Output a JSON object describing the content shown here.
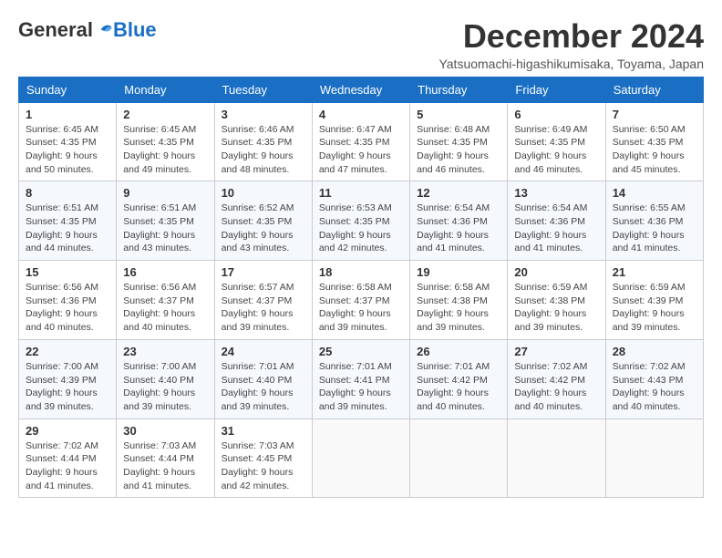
{
  "logo": {
    "general": "General",
    "blue": "Blue"
  },
  "title": "December 2024",
  "location": "Yatsuomachi-higashikumisaka, Toyama, Japan",
  "days_of_week": [
    "Sunday",
    "Monday",
    "Tuesday",
    "Wednesday",
    "Thursday",
    "Friday",
    "Saturday"
  ],
  "weeks": [
    [
      {
        "day": "1",
        "sunrise": "6:45 AM",
        "sunset": "4:35 PM",
        "daylight": "9 hours and 50 minutes."
      },
      {
        "day": "2",
        "sunrise": "6:45 AM",
        "sunset": "4:35 PM",
        "daylight": "9 hours and 49 minutes."
      },
      {
        "day": "3",
        "sunrise": "6:46 AM",
        "sunset": "4:35 PM",
        "daylight": "9 hours and 48 minutes."
      },
      {
        "day": "4",
        "sunrise": "6:47 AM",
        "sunset": "4:35 PM",
        "daylight": "9 hours and 47 minutes."
      },
      {
        "day": "5",
        "sunrise": "6:48 AM",
        "sunset": "4:35 PM",
        "daylight": "9 hours and 46 minutes."
      },
      {
        "day": "6",
        "sunrise": "6:49 AM",
        "sunset": "4:35 PM",
        "daylight": "9 hours and 46 minutes."
      },
      {
        "day": "7",
        "sunrise": "6:50 AM",
        "sunset": "4:35 PM",
        "daylight": "9 hours and 45 minutes."
      }
    ],
    [
      {
        "day": "8",
        "sunrise": "6:51 AM",
        "sunset": "4:35 PM",
        "daylight": "9 hours and 44 minutes."
      },
      {
        "day": "9",
        "sunrise": "6:51 AM",
        "sunset": "4:35 PM",
        "daylight": "9 hours and 43 minutes."
      },
      {
        "day": "10",
        "sunrise": "6:52 AM",
        "sunset": "4:35 PM",
        "daylight": "9 hours and 43 minutes."
      },
      {
        "day": "11",
        "sunrise": "6:53 AM",
        "sunset": "4:35 PM",
        "daylight": "9 hours and 42 minutes."
      },
      {
        "day": "12",
        "sunrise": "6:54 AM",
        "sunset": "4:36 PM",
        "daylight": "9 hours and 41 minutes."
      },
      {
        "day": "13",
        "sunrise": "6:54 AM",
        "sunset": "4:36 PM",
        "daylight": "9 hours and 41 minutes."
      },
      {
        "day": "14",
        "sunrise": "6:55 AM",
        "sunset": "4:36 PM",
        "daylight": "9 hours and 41 minutes."
      }
    ],
    [
      {
        "day": "15",
        "sunrise": "6:56 AM",
        "sunset": "4:36 PM",
        "daylight": "9 hours and 40 minutes."
      },
      {
        "day": "16",
        "sunrise": "6:56 AM",
        "sunset": "4:37 PM",
        "daylight": "9 hours and 40 minutes."
      },
      {
        "day": "17",
        "sunrise": "6:57 AM",
        "sunset": "4:37 PM",
        "daylight": "9 hours and 39 minutes."
      },
      {
        "day": "18",
        "sunrise": "6:58 AM",
        "sunset": "4:37 PM",
        "daylight": "9 hours and 39 minutes."
      },
      {
        "day": "19",
        "sunrise": "6:58 AM",
        "sunset": "4:38 PM",
        "daylight": "9 hours and 39 minutes."
      },
      {
        "day": "20",
        "sunrise": "6:59 AM",
        "sunset": "4:38 PM",
        "daylight": "9 hours and 39 minutes."
      },
      {
        "day": "21",
        "sunrise": "6:59 AM",
        "sunset": "4:39 PM",
        "daylight": "9 hours and 39 minutes."
      }
    ],
    [
      {
        "day": "22",
        "sunrise": "7:00 AM",
        "sunset": "4:39 PM",
        "daylight": "9 hours and 39 minutes."
      },
      {
        "day": "23",
        "sunrise": "7:00 AM",
        "sunset": "4:40 PM",
        "daylight": "9 hours and 39 minutes."
      },
      {
        "day": "24",
        "sunrise": "7:01 AM",
        "sunset": "4:40 PM",
        "daylight": "9 hours and 39 minutes."
      },
      {
        "day": "25",
        "sunrise": "7:01 AM",
        "sunset": "4:41 PM",
        "daylight": "9 hours and 39 minutes."
      },
      {
        "day": "26",
        "sunrise": "7:01 AM",
        "sunset": "4:42 PM",
        "daylight": "9 hours and 40 minutes."
      },
      {
        "day": "27",
        "sunrise": "7:02 AM",
        "sunset": "4:42 PM",
        "daylight": "9 hours and 40 minutes."
      },
      {
        "day": "28",
        "sunrise": "7:02 AM",
        "sunset": "4:43 PM",
        "daylight": "9 hours and 40 minutes."
      }
    ],
    [
      {
        "day": "29",
        "sunrise": "7:02 AM",
        "sunset": "4:44 PM",
        "daylight": "9 hours and 41 minutes."
      },
      {
        "day": "30",
        "sunrise": "7:03 AM",
        "sunset": "4:44 PM",
        "daylight": "9 hours and 41 minutes."
      },
      {
        "day": "31",
        "sunrise": "7:03 AM",
        "sunset": "4:45 PM",
        "daylight": "9 hours and 42 minutes."
      },
      null,
      null,
      null,
      null
    ]
  ]
}
